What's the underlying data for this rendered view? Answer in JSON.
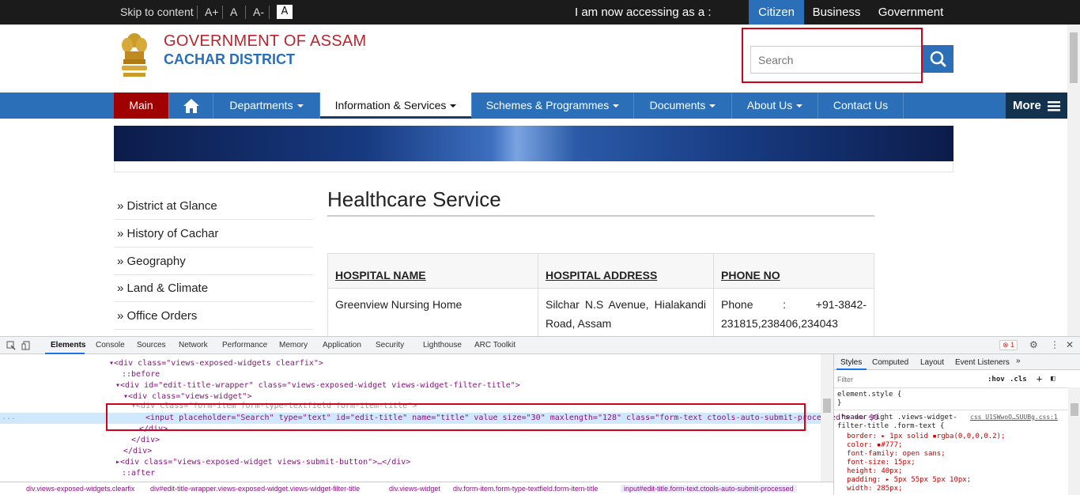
{
  "topbar": {
    "skip": "Skip to content",
    "font_large": "A+",
    "font_normal": "A",
    "font_small": "A-",
    "contrast": "A",
    "accessing": "I am now accessing as a :",
    "audiences": [
      "Citizen",
      "Business",
      "Government"
    ]
  },
  "header": {
    "title": "GOVERNMENT OF ASSAM",
    "subtitle": "CACHAR DISTRICT",
    "search_placeholder": "Search"
  },
  "nav": {
    "items": [
      "Main",
      "Departments",
      "Information & Services",
      "Schemes & Programmes",
      "Documents",
      "About Us",
      "Contact Us"
    ],
    "more": "More"
  },
  "sidebar": {
    "items": [
      "District at Glance",
      "History of Cachar",
      "Geography",
      "Land & Climate",
      "Office Orders"
    ]
  },
  "main": {
    "title": "Healthcare Service",
    "table": {
      "headers": [
        "HOSPITAL NAME",
        "HOSPITAL ADDRESS",
        "PHONE NO"
      ],
      "rows": [
        {
          "name": "Greenview Nursing Home",
          "address": "Silchar N.S Avenue, Hialakandi Road, Assam",
          "phone": "Phone : +91-3842-231815,238406,234043"
        }
      ]
    }
  },
  "devtools": {
    "tabs": [
      "Elements",
      "Console",
      "Sources",
      "Network",
      "Performance",
      "Memory",
      "Application",
      "Security",
      "Lighthouse",
      "ARC Toolkit"
    ],
    "error_count": "1",
    "code": {
      "l1": "<div class=\"views-exposed-widgets clearfix\">",
      "l2": "::before",
      "l3": "<div id=\"edit-title-wrapper\" class=\"views-exposed-widget views-widget-filter-title\">",
      "l4": "<div class=\"views-widget\">",
      "l5": "<div class=\"form-item form-type-textfield form-item-title\">",
      "l6": "<input placeholder=\"Search\" type=\"text\" id=\"edit-title\" name=\"title\" value size=\"30\" maxlength=\"128\" class=\"form-text ctools-auto-submit-processed\"> == $0",
      "l7": "</div>",
      "l8": "</div>",
      "l9": "</div>",
      "l10": "<div class=\"views-exposed-widget views-submit-button\">…</div>",
      "l11": "::after"
    },
    "styles_tabs": [
      "Styles",
      "Computed",
      "Layout",
      "Event Listeners"
    ],
    "filter_placeholder": "Filter",
    "hov": ":hov",
    "cls": ".cls",
    "styles": {
      "element_style": "element.style {",
      "close": "}",
      "rule_selector": ".header-right .views-widget-filter-title .form-text {",
      "rule_source": "css_U1SWwoO…SUUBg.css:1",
      "props": [
        "border: ▸ 1px solid ▪rgba(0,0,0,0.2);",
        "color: ▪#777;",
        "font-family: open sans;",
        "font-size: 15px;",
        "height: 40px;",
        "padding: ▸ 5px 55px 5px 10px;",
        "width: 285px;"
      ]
    },
    "breadcrumbs": [
      "div.views-exposed-widgets.clearfix",
      "div#edit-title-wrapper.views-exposed-widget.views-widget-filter-title",
      "div.views-widget",
      "div.form-item.form-type-textfield.form-item-title",
      "input#edit-title.form-text.ctools-auto-submit-processed"
    ]
  },
  "colors": {
    "nav_blue": "#2a6fb8",
    "main_red": "#a00000",
    "highlight_red": "#d0021b",
    "header_red": "#b5262e",
    "header_blue": "#2a6fb8"
  }
}
